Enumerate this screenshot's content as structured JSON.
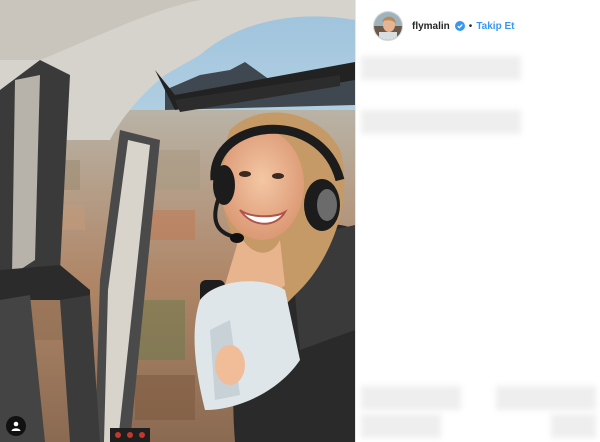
{
  "post": {
    "username": "flymalin",
    "follow_label": "Takip Et",
    "separator": "•"
  },
  "icons": {
    "verified": "verified-badge-icon",
    "user_tag": "user-tag-icon"
  },
  "colors": {
    "follow_blue": "#3897f0",
    "verified_blue": "#3897f0",
    "text_dark": "#262626"
  }
}
